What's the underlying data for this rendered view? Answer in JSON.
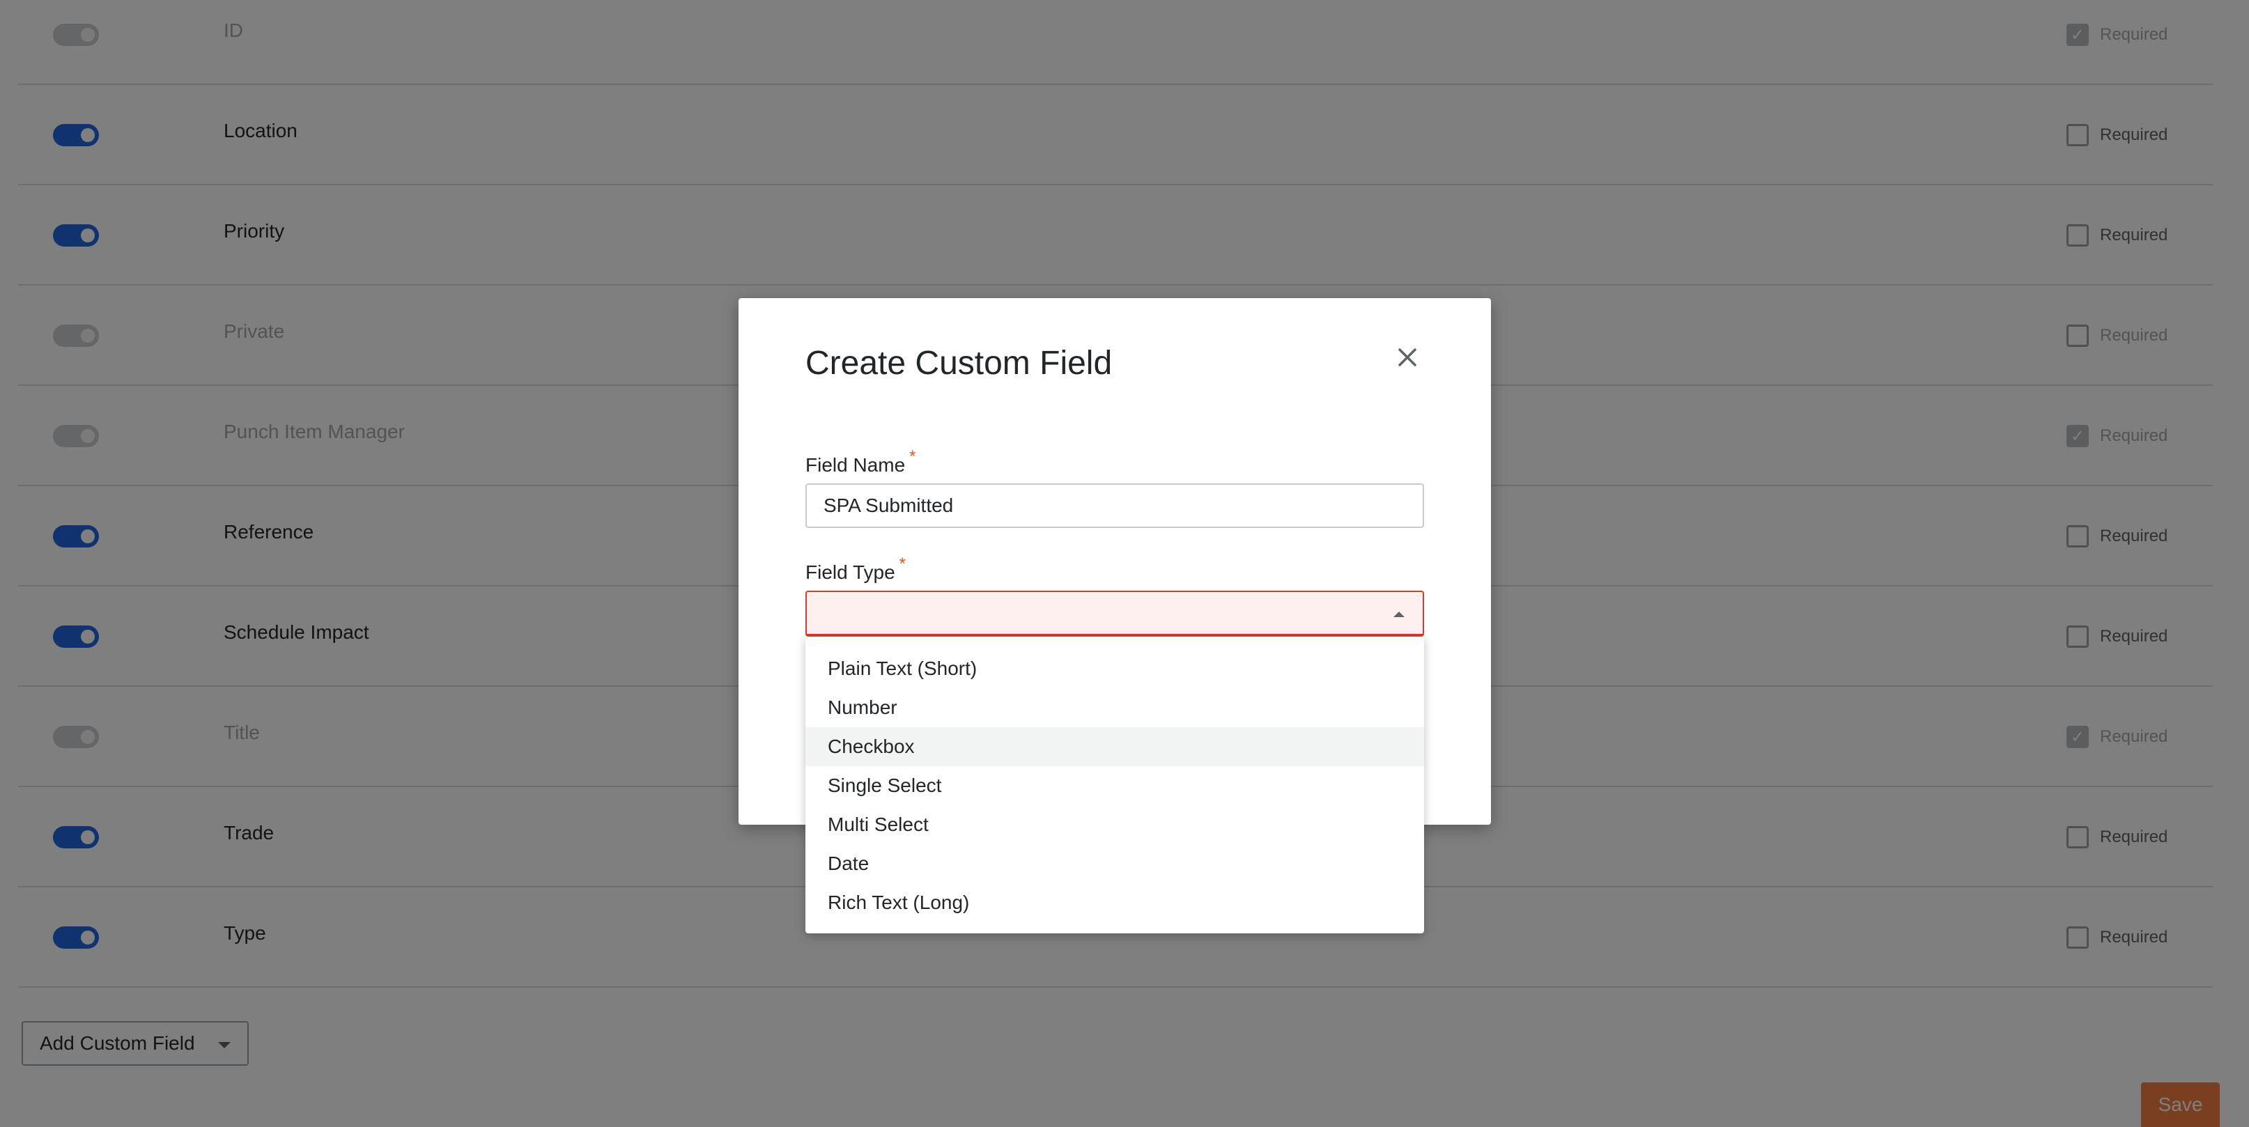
{
  "field_rows": [
    {
      "label": "ID",
      "enabled": false,
      "disabled": true,
      "required": true
    },
    {
      "label": "Location",
      "enabled": true,
      "disabled": false,
      "required": false
    },
    {
      "label": "Priority",
      "enabled": true,
      "disabled": false,
      "required": false
    },
    {
      "label": "Private",
      "enabled": false,
      "disabled": true,
      "required": false
    },
    {
      "label": "Punch Item Manager",
      "enabled": false,
      "disabled": true,
      "required": true
    },
    {
      "label": "Reference",
      "enabled": true,
      "disabled": false,
      "required": false
    },
    {
      "label": "Schedule Impact",
      "enabled": true,
      "disabled": false,
      "required": false
    },
    {
      "label": "Title",
      "enabled": false,
      "disabled": true,
      "required": true
    },
    {
      "label": "Trade",
      "enabled": true,
      "disabled": false,
      "required": false
    },
    {
      "label": "Type",
      "enabled": true,
      "disabled": false,
      "required": false
    }
  ],
  "required_label": "Required",
  "add_custom_field": {
    "label": "Add Custom Field"
  },
  "save": {
    "label": "Save"
  },
  "modal": {
    "title": "Create Custom Field",
    "field_name": {
      "label": "Field Name",
      "value": "SPA Submitted"
    },
    "field_type": {
      "label": "Field Type",
      "value": "",
      "options": [
        "Plain Text (Short)",
        "Number",
        "Checkbox",
        "Single Select",
        "Multi Select",
        "Date",
        "Rich Text (Long)"
      ],
      "hovered_option": "Checkbox"
    },
    "required_marker": "*"
  },
  "colors": {
    "accent": "#2066df",
    "save": "#f47e42",
    "required_star": "#e55a1c",
    "error_border": "#d83b2c"
  }
}
